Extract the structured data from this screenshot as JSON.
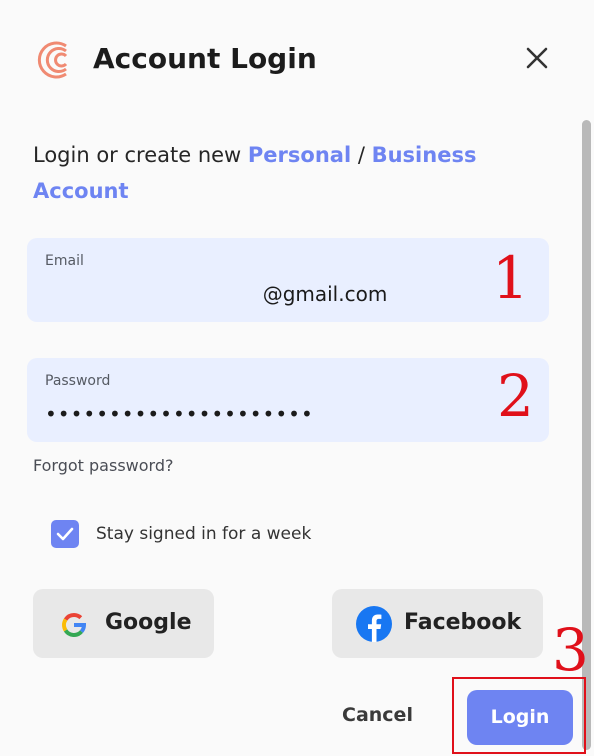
{
  "dialog": {
    "title": "Account Login",
    "logo_icon": "brand-c-logo-icon",
    "close_icon": "close-icon"
  },
  "intro": {
    "prefix": "Login or create new ",
    "personal_link": "Personal",
    "separator": " / ",
    "business_link": "Business Account"
  },
  "email": {
    "label": "Email",
    "value": "@gmail.com"
  },
  "password": {
    "label": "Password",
    "value": "•••••••••••••••••••••"
  },
  "forgot_password": "Forgot password?",
  "stay_signed_in": {
    "label": "Stay signed in for a week",
    "checked": true
  },
  "social": {
    "google_label": "Google",
    "google_icon": "google-icon",
    "facebook_label": "Facebook",
    "facebook_icon": "facebook-icon"
  },
  "actions": {
    "cancel_label": "Cancel",
    "login_label": "Login"
  },
  "annotations": {
    "step1": "1",
    "step2": "2",
    "step3": "3"
  },
  "colors": {
    "accent": "#6e84f2",
    "field_bg": "#e9efff",
    "brand_logo": "#f08a72",
    "annotation_red": "#e0101a"
  }
}
